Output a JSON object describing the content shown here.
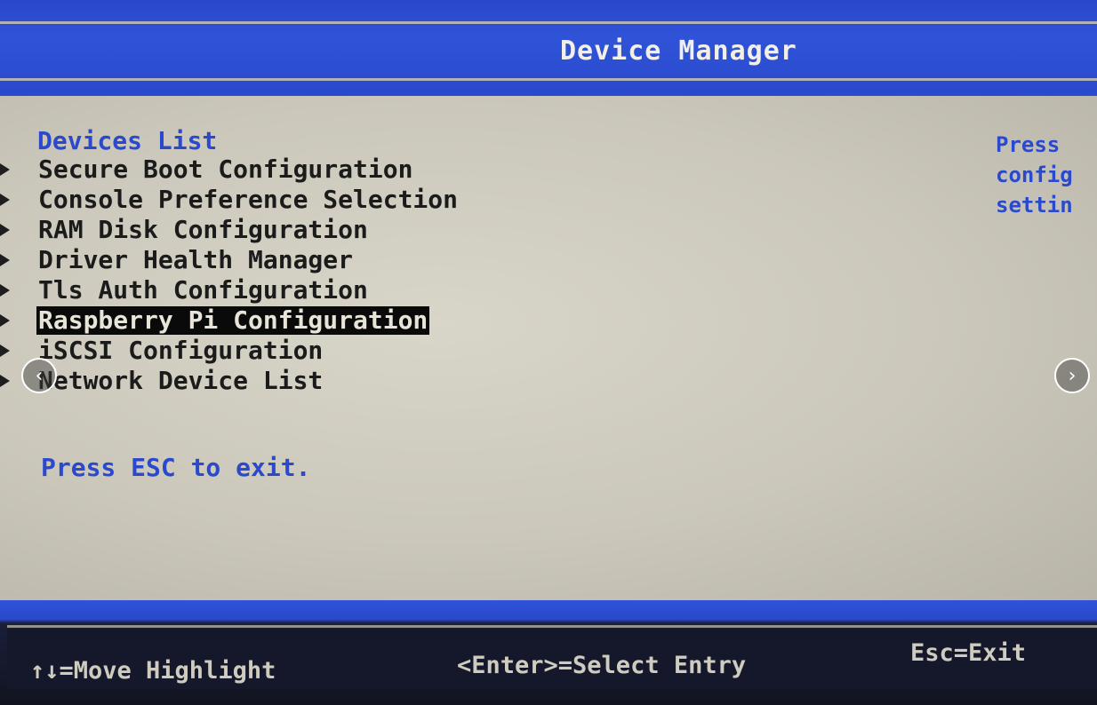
{
  "window": {
    "title": "Device Manager"
  },
  "devices_list": {
    "heading": "Devices List",
    "items": [
      {
        "label": "Secure Boot Configuration",
        "selected": false
      },
      {
        "label": "Console Preference Selection",
        "selected": false
      },
      {
        "label": "RAM Disk Configuration",
        "selected": false
      },
      {
        "label": "Driver Health Manager",
        "selected": false
      },
      {
        "label": "Tls Auth Configuration",
        "selected": false
      },
      {
        "label": "Raspberry Pi Configuration",
        "selected": true
      },
      {
        "label": "iSCSI Configuration",
        "selected": false
      },
      {
        "label": "Network Device List",
        "selected": false
      }
    ]
  },
  "help_panel": {
    "lines": [
      "Press",
      "config",
      "settin"
    ]
  },
  "exit_hint": "Press ESC to exit.",
  "footer": {
    "move": "↑↓=Move Highlight",
    "select": "<Enter>=Select Entry",
    "exit": "Esc=Exit"
  },
  "viewer": {
    "prev_icon": "‹",
    "next_icon": "›"
  },
  "colors": {
    "title_bar": "#2a49cc",
    "body_background": "#cbc8bb",
    "accent_text": "#2a49cc",
    "selection_background": "#0a0a0a",
    "footer_background": "#15182a"
  }
}
